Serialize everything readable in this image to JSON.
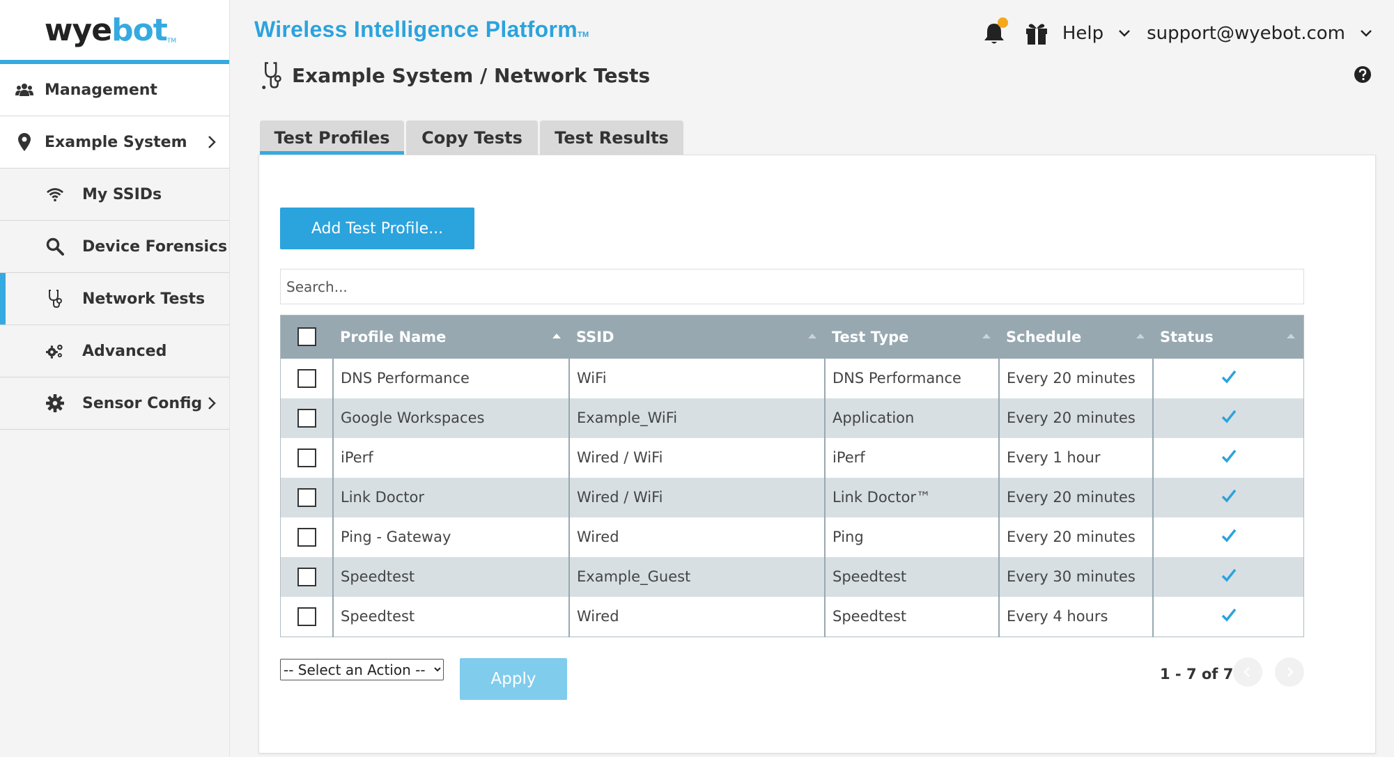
{
  "logo": {
    "wye": "wye",
    "bot": "bot",
    "tm": "TM"
  },
  "app_title": {
    "text": "Wireless Intelligence Platform",
    "tm": "TM"
  },
  "header": {
    "help_label": "Help",
    "user_email": "support@wyebot.com"
  },
  "breadcrumb": {
    "text": "Example System / Network Tests"
  },
  "sidebar": {
    "items": [
      {
        "label": "Management",
        "icon": "users-icon"
      },
      {
        "label": "Example System",
        "icon": "map-pin-icon"
      },
      {
        "label": "My SSIDs",
        "icon": "wifi-icon"
      },
      {
        "label": "Device Forensics",
        "icon": "search-icon"
      },
      {
        "label": "Network Tests",
        "icon": "stethoscope-icon",
        "active": true
      },
      {
        "label": "Advanced",
        "icon": "gears-icon"
      },
      {
        "label": "Sensor Config",
        "icon": "gear-icon"
      }
    ]
  },
  "tabs": [
    {
      "label": "Test Profiles",
      "active": true
    },
    {
      "label": "Copy Tests"
    },
    {
      "label": "Test Results"
    }
  ],
  "add_button": {
    "label": "Add Test Profile..."
  },
  "search": {
    "placeholder": "Search..."
  },
  "table": {
    "columns": [
      "Profile Name",
      "SSID",
      "Test Type",
      "Schedule",
      "Status"
    ],
    "rows": [
      {
        "name": "DNS Performance",
        "ssid": "WiFi",
        "type": "DNS Performance",
        "schedule": "Every 20 minutes",
        "status": "enabled"
      },
      {
        "name": "Google Workspaces",
        "ssid": "Example_WiFi",
        "type": "Application",
        "schedule": "Every 20 minutes",
        "status": "enabled"
      },
      {
        "name": "iPerf",
        "ssid": "Wired / WiFi",
        "type": "iPerf",
        "schedule": "Every 1 hour",
        "status": "enabled"
      },
      {
        "name": "Link Doctor",
        "ssid": "Wired / WiFi",
        "type": "Link Doctor™",
        "schedule": "Every 20 minutes",
        "status": "enabled"
      },
      {
        "name": "Ping - Gateway",
        "ssid": "Wired",
        "type": "Ping",
        "schedule": "Every 20 minutes",
        "status": "enabled"
      },
      {
        "name": "Speedtest",
        "ssid": "Example_Guest",
        "type": "Speedtest",
        "schedule": "Every 30 minutes",
        "status": "enabled"
      },
      {
        "name": "Speedtest",
        "ssid": "Wired",
        "type": "Speedtest",
        "schedule": "Every 4 hours",
        "status": "enabled"
      }
    ]
  },
  "actions": {
    "select_label": "-- Select an Action --",
    "apply_label": "Apply"
  },
  "pagination": {
    "text": "1 - 7 of 7"
  },
  "colors": {
    "accent": "#2ba3dd",
    "header_row": "#97a8b1",
    "alt_row": "#d7dfe3",
    "notification": "#f5a81c"
  }
}
